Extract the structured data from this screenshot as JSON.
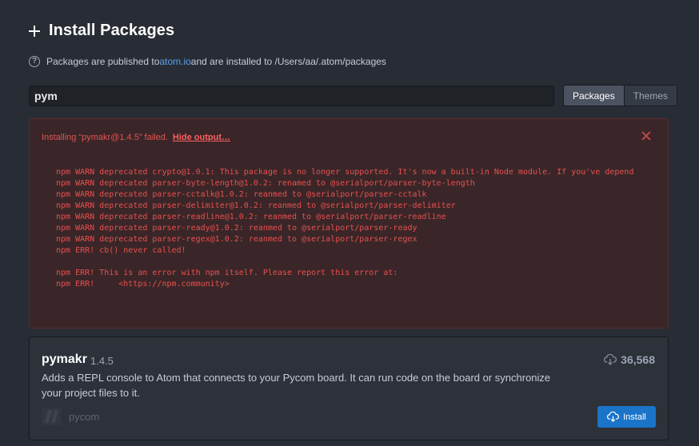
{
  "header": {
    "title": "Install Packages",
    "info_prefix": "Packages are published to ",
    "info_link": "atom.io",
    "info_suffix": " and are installed to /Users/aa/.atom/packages"
  },
  "search": {
    "value": "pym"
  },
  "segments": {
    "packages_label": "Packages",
    "themes_label": "Themes",
    "selected": "Packages"
  },
  "error": {
    "message": "Installing “pymakr@1.4.5” failed.",
    "hide_link": "Hide output…",
    "output": [
      "npm WARN deprecated crypto@1.0.1: This package is no longer supported. It's now a built-in Node module. If you've depend",
      "npm WARN deprecated parser-byte-length@1.0.2: renamed to @serialport/parser-byte-length",
      "npm WARN deprecated parser-cctalk@1.0.2: reanmed to @serialport/parser-cctalk",
      "npm WARN deprecated parser-delimiter@1.0.2: reanmed to @serialport/parser-delimiter",
      "npm WARN deprecated parser-readline@1.0.2: reanmed to @serialport/parser-readline",
      "npm WARN deprecated parser-ready@1.0.2: reanmed to @serialport/parser-ready",
      "npm WARN deprecated parser-regex@1.0.2: reanmed to @serialport/parser-regex",
      "npm ERR! cb() never called!",
      "",
      "npm ERR! This is an error with npm itself. Please report this error at:",
      "npm ERR!     <https://npm.community>"
    ]
  },
  "package": {
    "name": "pymakr",
    "version": "1.4.5",
    "downloads": "36,568",
    "description": "Adds a REPL console to Atom that connects to your Pycom board. It can run code on the board or synchronize your project files to it.",
    "owner": "pycom",
    "install_label": "Install"
  },
  "colors": {
    "accent": "#1a75c9",
    "error": "#e94f4f",
    "link": "#5aa1f0"
  }
}
